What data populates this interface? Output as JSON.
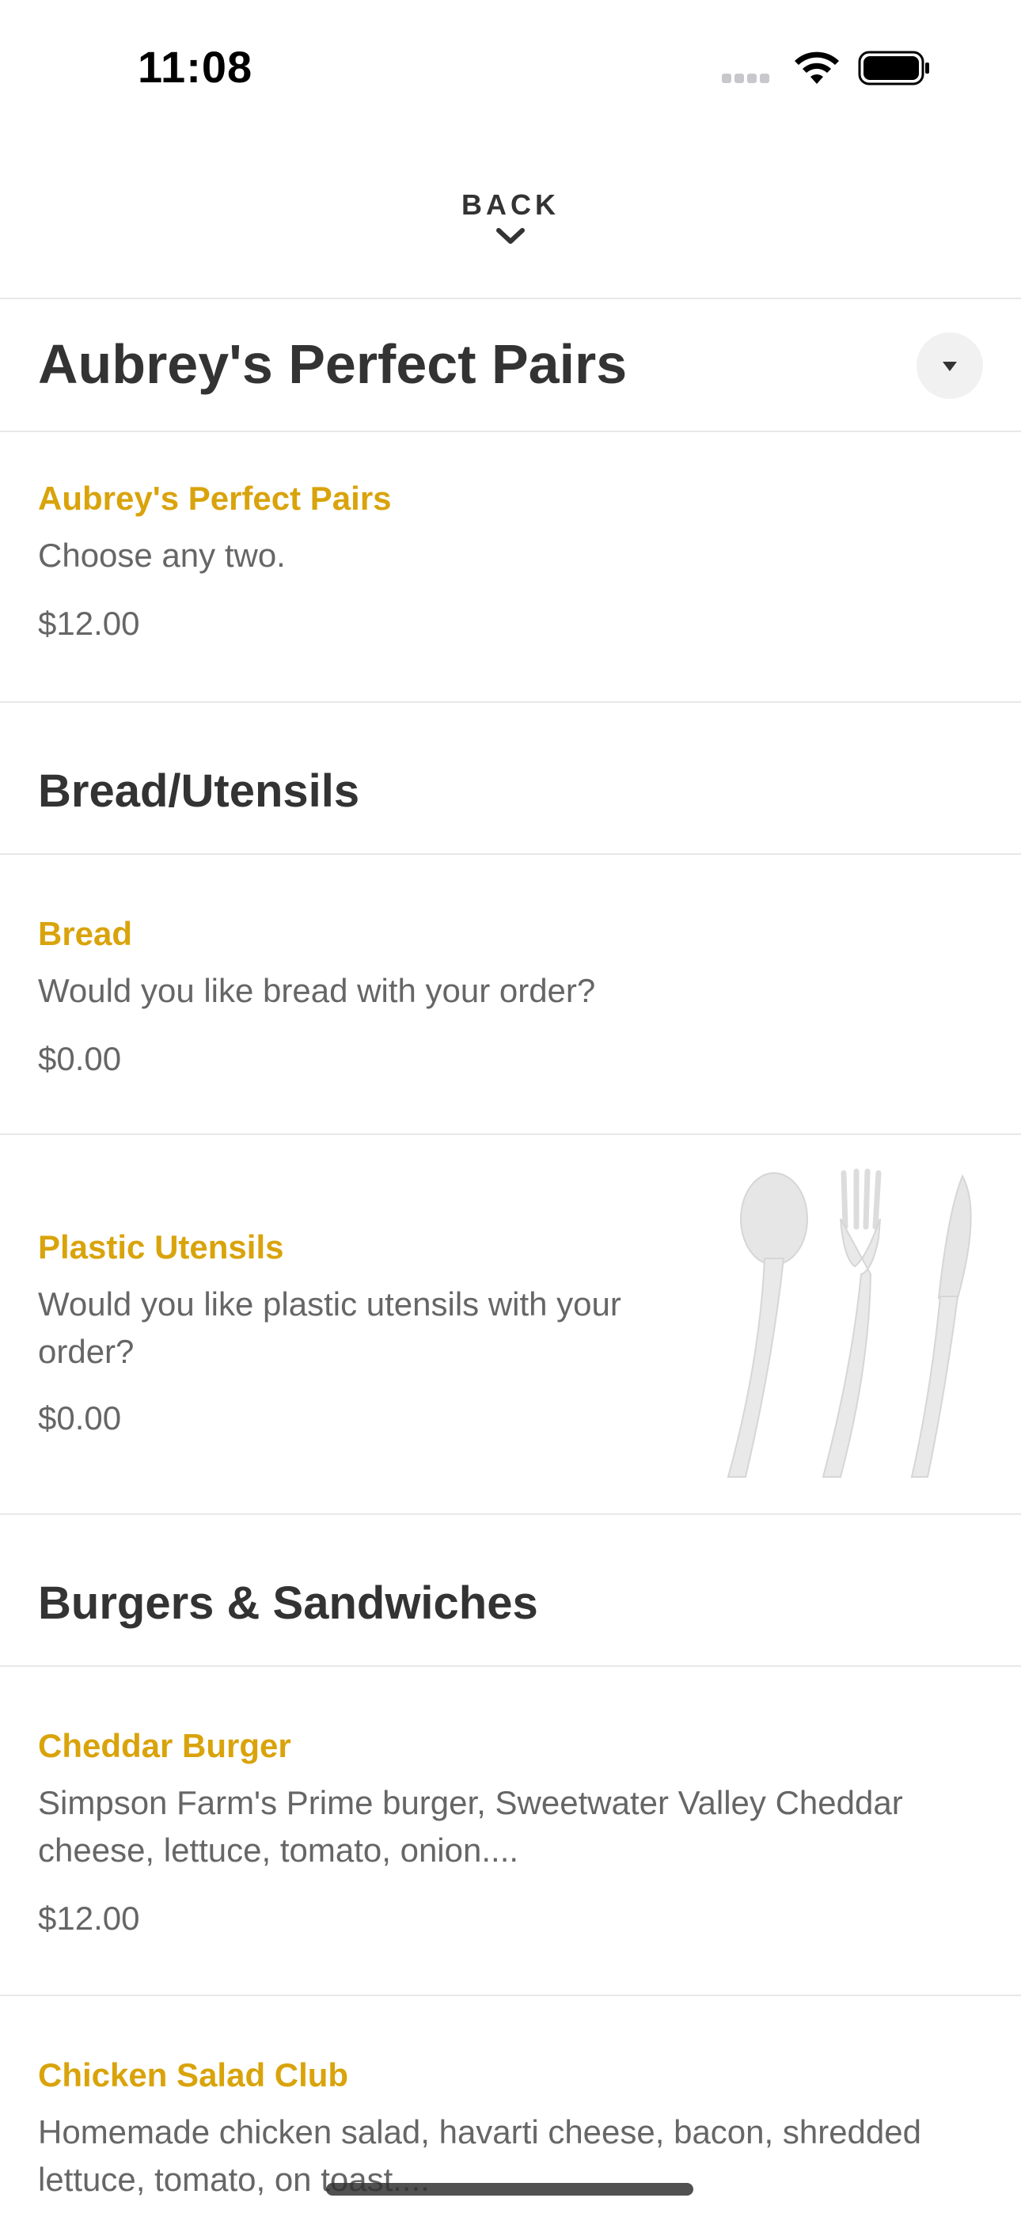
{
  "status_bar": {
    "time": "11:08",
    "icons": [
      "cellular-signal-icon",
      "wifi-icon",
      "battery-icon"
    ]
  },
  "nav": {
    "back_label": "BACK",
    "back_icon": "chevron-down-icon"
  },
  "menu": {
    "title": "Aubrey's Perfect Pairs",
    "dropdown_icon": "caret-down-icon"
  },
  "items": {
    "perfect_pairs": {
      "name": "Aubrey's Perfect Pairs",
      "description": "Choose any two.",
      "price": "$12.00"
    },
    "bread": {
      "name": "Bread",
      "description": "Would you like bread with your order?",
      "price": "$0.00"
    },
    "plastic_utensils": {
      "name": "Plastic Utensils",
      "description": "Would you like plastic utensils with your order?",
      "price": "$0.00",
      "image": "plastic-utensils-image"
    },
    "cheddar_burger": {
      "name": "Cheddar Burger",
      "description": "Simpson Farm's Prime burger, Sweetwater Valley Cheddar cheese, lettuce, tomato, onion....",
      "price": "$12.00"
    },
    "chicken_salad_club": {
      "name": "Chicken Salad Club",
      "description": "Homemade chicken salad, havarti cheese, bacon, shredded lettuce, tomato, on toast...."
    }
  },
  "sections": {
    "bread_utensils": "Bread/Utensils",
    "burgers_sandwiches": "Burgers & Sandwiches"
  },
  "colors": {
    "accent": "#d9a30b",
    "text_primary": "#333333",
    "text_secondary": "#666666",
    "divider": "#e8e8e8"
  }
}
